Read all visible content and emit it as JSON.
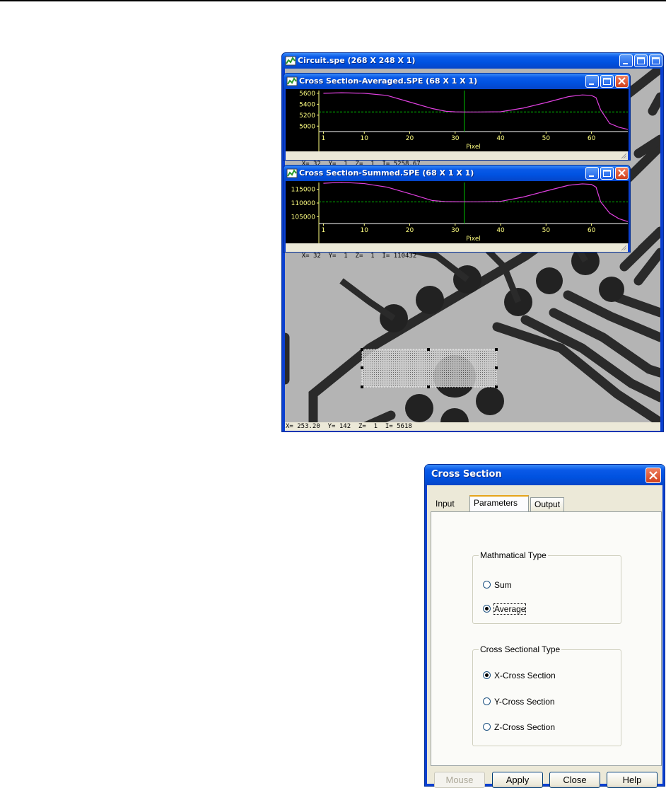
{
  "main_window": {
    "title": "Circuit.spe (268 X 248 X 1)",
    "status": "X= 253.20  Y= 142  Z=  1  I= 5618"
  },
  "averaged_window": {
    "title": "Cross Section-Averaged.SPE (68 X 1 X 1)",
    "status": "X= 32  Y=  1  Z=  1  I= 5258.67",
    "chart_data": {
      "type": "line",
      "xlabel": "Pixel",
      "x_ticks": [
        "1",
        "10",
        "20",
        "30",
        "40",
        "50",
        "60"
      ],
      "y_ticks": [
        "5600",
        "5400",
        "5200",
        "5000"
      ],
      "xlim": [
        0,
        68
      ],
      "ylim": [
        4900,
        5650
      ],
      "cursor_x": 32,
      "cursor_y": 5258.67,
      "series": [
        {
          "color": "#e040e0",
          "x": [
            1,
            5,
            10,
            15,
            20,
            25,
            28,
            30,
            32,
            35,
            40,
            45,
            50,
            55,
            58,
            60,
            61,
            62,
            64,
            66,
            68
          ],
          "values": [
            5600,
            5610,
            5600,
            5560,
            5440,
            5320,
            5270,
            5260,
            5258,
            5258,
            5262,
            5330,
            5430,
            5540,
            5570,
            5560,
            5520,
            5300,
            5050,
            4980,
            4940
          ]
        }
      ]
    }
  },
  "summed_window": {
    "title": "Cross Section-Summed.SPE (68 X 1 X 1)",
    "status": "X= 32  Y=  1  Z=  1  I= 110432",
    "chart_data": {
      "type": "line",
      "xlabel": "Pixel",
      "x_ticks": [
        "1",
        "10",
        "20",
        "30",
        "40",
        "50",
        "60"
      ],
      "y_ticks": [
        "115000",
        "110000",
        "105000"
      ],
      "xlim": [
        0,
        68
      ],
      "ylim": [
        102500,
        117500
      ],
      "cursor_x": 32,
      "cursor_y": 110432,
      "series": [
        {
          "color": "#e040e0",
          "x": [
            1,
            5,
            10,
            15,
            20,
            25,
            28,
            30,
            32,
            35,
            40,
            45,
            50,
            55,
            58,
            60,
            61,
            62,
            64,
            66,
            68
          ],
          "values": [
            117200,
            117600,
            117100,
            115800,
            113400,
            110900,
            110500,
            110450,
            110432,
            110440,
            110600,
            112200,
            114400,
            116500,
            117000,
            116800,
            115800,
            110500,
            106300,
            104300,
            103200
          ]
        }
      ]
    }
  },
  "dialog": {
    "title": "Cross Section",
    "tabs": [
      "Input",
      "Parameters",
      "Output"
    ],
    "group1": {
      "legend": "Mathmatical Type",
      "options": [
        "Sum",
        "Average"
      ],
      "selected": "Average"
    },
    "group2": {
      "legend": "Cross Sectional Type",
      "options": [
        "X-Cross Section",
        "Y-Cross Section",
        "Z-Cross Section"
      ],
      "selected": "X-Cross Section"
    },
    "buttons": {
      "mouse": "Mouse",
      "apply": "Apply",
      "close": "Close",
      "help": "Help"
    }
  },
  "colors": {
    "title_blue": "#0a5ae8",
    "plot_bg": "#000000",
    "curve": "#e040e0",
    "cursor": "#00c000",
    "axis": "#ffff80"
  },
  "icons": [
    "app-chart-icon",
    "minimize-icon",
    "maximize-icon",
    "close-icon",
    "resize-grip-icon"
  ]
}
